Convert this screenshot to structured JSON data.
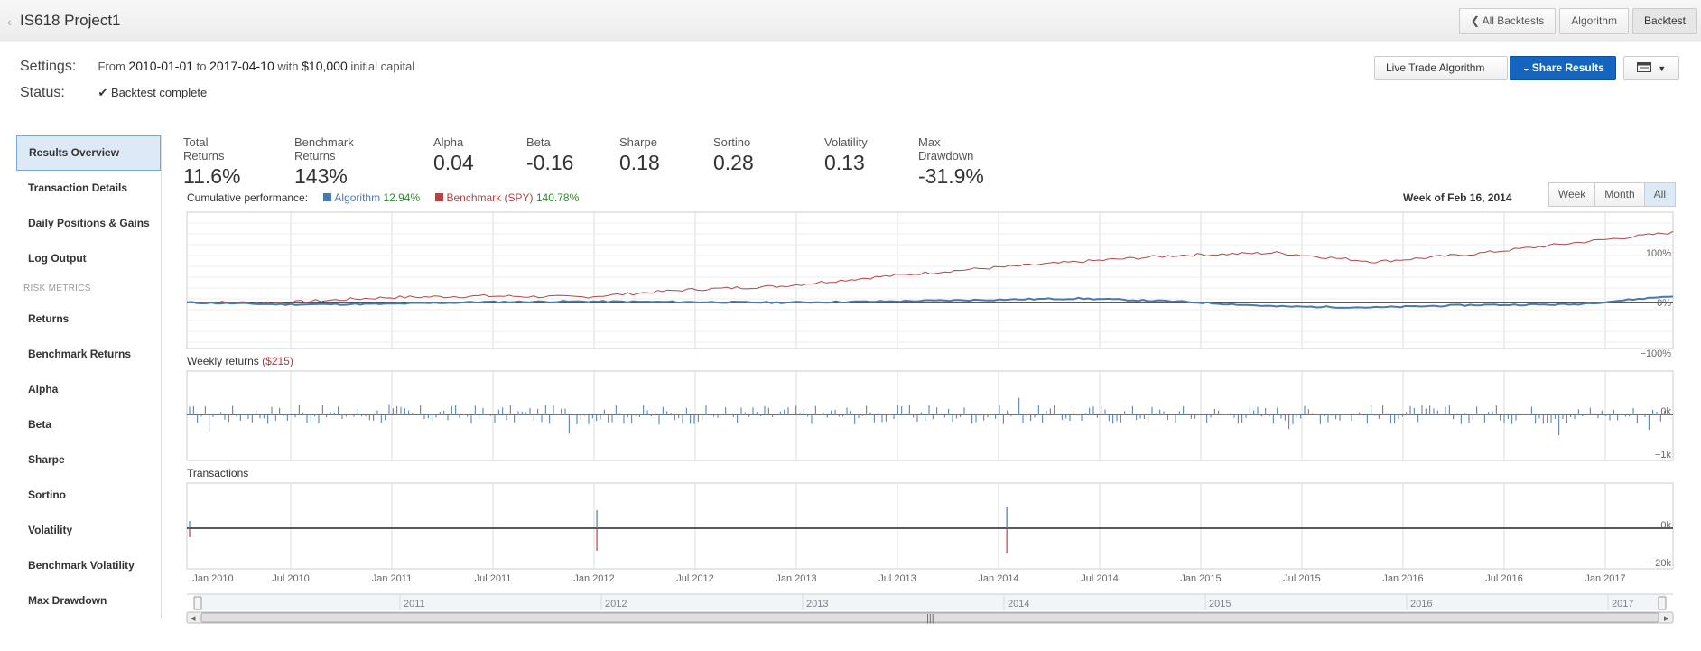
{
  "topbar": {
    "back_glyph": "‹",
    "title": "IS618 Project1",
    "nav": [
      {
        "label": "❮ All Backtests",
        "active": false
      },
      {
        "label": "Algorithm",
        "active": false
      },
      {
        "label": "Backtest",
        "active": true
      }
    ]
  },
  "settings": {
    "settings_label": "Settings:",
    "from_text": "From",
    "start_date": "2010-01-01",
    "to_text": "to",
    "end_date": "2017-04-10",
    "with_text": "with",
    "capital": "$10,000",
    "capital_suffix": "initial capital",
    "status_label": "Status:",
    "status_value": "✔ Backtest complete"
  },
  "actions": {
    "live_trade": "Live Trade Algorithm",
    "share": "Share Results",
    "share_icon": "chat-icon",
    "layout_menu_icon": "layout-icon"
  },
  "sidebar": {
    "items": [
      {
        "label": "Results Overview",
        "active": true
      },
      {
        "label": "Transaction Details"
      },
      {
        "label": "Daily Positions & Gains"
      },
      {
        "label": "Log Output"
      }
    ],
    "risk_heading": "RISK METRICS",
    "risk_items": [
      {
        "label": "Returns"
      },
      {
        "label": "Benchmark Returns"
      },
      {
        "label": "Alpha"
      },
      {
        "label": "Beta"
      },
      {
        "label": "Sharpe"
      },
      {
        "label": "Sortino"
      },
      {
        "label": "Volatility"
      },
      {
        "label": "Benchmark Volatility"
      },
      {
        "label": "Max Drawdown"
      }
    ]
  },
  "metrics": [
    {
      "label": "Total Returns",
      "value": "11.6%"
    },
    {
      "label": "Benchmark Returns",
      "value": "143%"
    },
    {
      "label": "Alpha",
      "value": "0.04"
    },
    {
      "label": "Beta",
      "value": "-0.16"
    },
    {
      "label": "Sharpe",
      "value": "0.18"
    },
    {
      "label": "Sortino",
      "value": "0.28"
    },
    {
      "label": "Volatility",
      "value": "0.13"
    },
    {
      "label": "Max Drawdown",
      "value": "-31.9%"
    }
  ],
  "cumulative": {
    "title": "Cumulative performance:",
    "algo_label": "Algorithm",
    "algo_value": "12.94%",
    "bench_label": "Benchmark (SPY)",
    "bench_value": "140.78%",
    "week_of": "Week of Feb 16, 2014",
    "ranges": [
      {
        "label": "Week",
        "active": false
      },
      {
        "label": "Month",
        "active": false
      },
      {
        "label": "All",
        "active": true
      }
    ]
  },
  "weekly": {
    "title": "Weekly returns",
    "value": "($215)"
  },
  "transactions": {
    "title": "Transactions"
  },
  "colors": {
    "algorithm": "#4a78b0",
    "benchmark": "#b24444",
    "primary_button": "#1565c0"
  },
  "chart_data": [
    {
      "type": "line",
      "name": "cumulative-performance",
      "x": [
        "2010-01",
        "2010-07",
        "2011-01",
        "2011-07",
        "2012-01",
        "2012-07",
        "2013-01",
        "2013-07",
        "2014-01",
        "2014-07",
        "2015-01",
        "2015-07",
        "2016-01",
        "2016-07",
        "2017-01",
        "2017-04"
      ],
      "series": [
        {
          "name": "Algorithm",
          "values": [
            0,
            -4,
            -3,
            1,
            2,
            1,
            0,
            2,
            5,
            8,
            2,
            -8,
            -10,
            -5,
            -4,
            13
          ]
        },
        {
          "name": "Benchmark (SPY)",
          "values": [
            0,
            0,
            10,
            13,
            11,
            25,
            33,
            52,
            68,
            82,
            95,
            100,
            82,
            98,
            120,
            141
          ]
        }
      ],
      "y_tick_labels": [
        "100%",
        "0%",
        "−100%"
      ],
      "ylim": [
        -100,
        140
      ]
    },
    {
      "type": "bar",
      "name": "weekly-returns",
      "y_tick_labels": [
        "0k",
        "−1k"
      ],
      "ylim": [
        -1000,
        1000
      ]
    },
    {
      "type": "bar",
      "name": "transactions",
      "y_tick_labels": [
        "0k",
        "−20k"
      ],
      "events": [
        {
          "date": "2010-01",
          "buy": 8000,
          "sell": -10000
        },
        {
          "date": "2012-01",
          "buy": 20000,
          "sell": -25000
        },
        {
          "date": "2014-01",
          "buy": 24000,
          "sell": -28000
        }
      ]
    },
    {
      "type": "table",
      "name": "time-axis",
      "x_tick_labels": [
        "Jan 2010",
        "Jul 2010",
        "Jan 2011",
        "Jul 2011",
        "Jan 2012",
        "Jul 2012",
        "Jan 2013",
        "Jul 2013",
        "Jan 2014",
        "Jul 2014",
        "Jan 2015",
        "Jul 2015",
        "Jan 2016",
        "Jul 2016",
        "Jan 2017"
      ],
      "navigator_years": [
        "2011",
        "2012",
        "2013",
        "2014",
        "2015",
        "2016",
        "2017"
      ]
    }
  ]
}
